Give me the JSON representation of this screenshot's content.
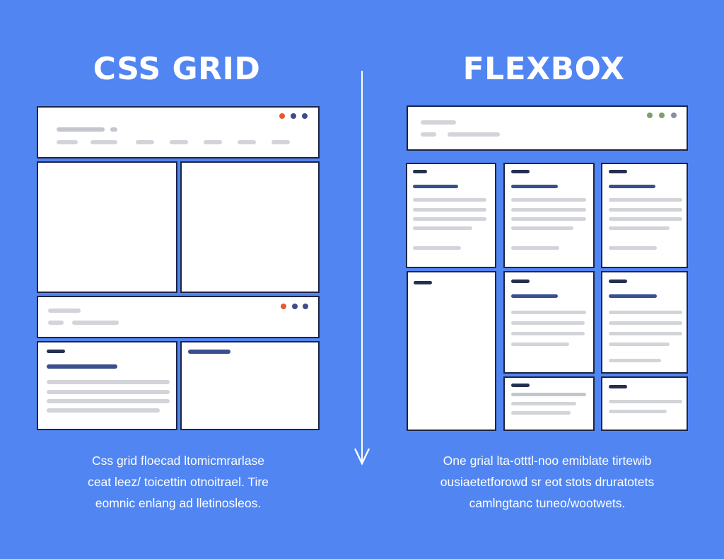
{
  "left": {
    "title": "CSS GRID",
    "caption": [
      "Css grid floecad ltomicmrarlase",
      "ceat leez/ toicettin otnoitrael. Tire",
      "eomnic enlang ad lletinosleos."
    ]
  },
  "right": {
    "title": "FLEXBOX",
    "caption": [
      "One grial lta-otttl-noo emiblate tirtewib",
      "ousiaetetforowd sr eot stots druratotets",
      "camlngtanc tuneo/wootwets."
    ]
  },
  "colors": {
    "background": "#5185F2",
    "panel": "#FFFFFF",
    "border": "#1C2545",
    "accent_line": "#3A4F8E",
    "dot_red": "#E8582F",
    "dot_navy": "#3D4C8A",
    "dot_green": "#7E9E6E",
    "dot_grey": "#8A8FA0"
  }
}
